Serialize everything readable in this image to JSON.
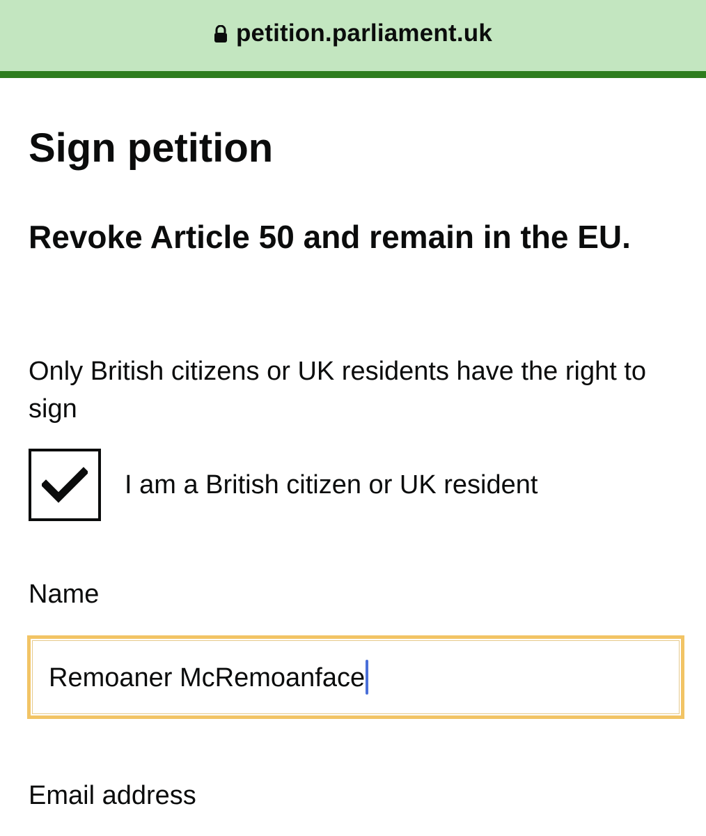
{
  "browser": {
    "url": "petition.parliament.uk",
    "lock_icon": "lock-icon"
  },
  "colors": {
    "address_bar": "#c3e6c0",
    "accent_rule": "#2e7d1e",
    "focus_outline": "#f2c465",
    "cursor": "#4a6fd8"
  },
  "page": {
    "title": "Sign petition",
    "petition_title": "Revoke Article 50 and remain in the EU.",
    "eligibility_text": "Only British citizens or UK residents have the right to sign"
  },
  "form": {
    "eligibility_checkbox": {
      "label": "I am a British citizen or UK resident",
      "checked": true,
      "icon": "checkmark-icon"
    },
    "name": {
      "label": "Name",
      "value": "Remoaner McRemoanface"
    },
    "email": {
      "label": "Email address"
    }
  }
}
